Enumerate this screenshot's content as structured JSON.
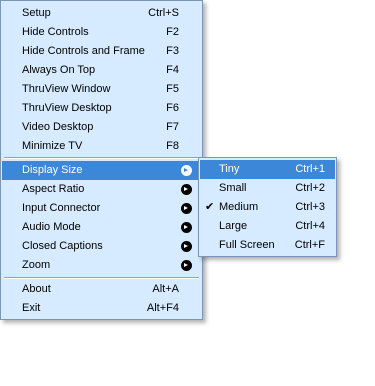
{
  "main_menu": {
    "items": [
      {
        "label": "Setup",
        "shortcut": "Ctrl+S"
      },
      {
        "label": "Hide Controls",
        "shortcut": "F2"
      },
      {
        "label": "Hide Controls and Frame",
        "shortcut": "F3"
      },
      {
        "label": "Always On Top",
        "shortcut": "F4"
      },
      {
        "label": "ThruView Window",
        "shortcut": "F5"
      },
      {
        "label": "ThruView Desktop",
        "shortcut": "F6"
      },
      {
        "label": "Video Desktop",
        "shortcut": "F7"
      },
      {
        "label": "Minimize TV",
        "shortcut": "F8"
      },
      {
        "label": "Display Size",
        "submenu": true,
        "selected": true
      },
      {
        "label": "Aspect Ratio",
        "submenu": true
      },
      {
        "label": "Input Connector",
        "submenu": true
      },
      {
        "label": "Audio Mode",
        "submenu": true
      },
      {
        "label": "Closed Captions",
        "submenu": true
      },
      {
        "label": "Zoom",
        "submenu": true
      },
      {
        "label": "About",
        "shortcut": "Alt+A"
      },
      {
        "label": "Exit",
        "shortcut": "Alt+F4"
      }
    ]
  },
  "display_size_submenu": {
    "items": [
      {
        "label": "Tiny",
        "shortcut": "Ctrl+1",
        "selected": true
      },
      {
        "label": "Small",
        "shortcut": "Ctrl+2"
      },
      {
        "label": "Medium",
        "shortcut": "Ctrl+3",
        "checked": true
      },
      {
        "label": "Large",
        "shortcut": "Ctrl+4"
      },
      {
        "label": "Full Screen",
        "shortcut": "Ctrl+F"
      }
    ]
  },
  "icons": {
    "submenu_arrow": "submenu-arrow-icon",
    "checkmark": "checkmark-icon",
    "check_glyph": "✔"
  },
  "colors": {
    "menu_background": "#d6ebff",
    "highlight": "#3d87d9",
    "highlight_text": "#ffffff"
  }
}
